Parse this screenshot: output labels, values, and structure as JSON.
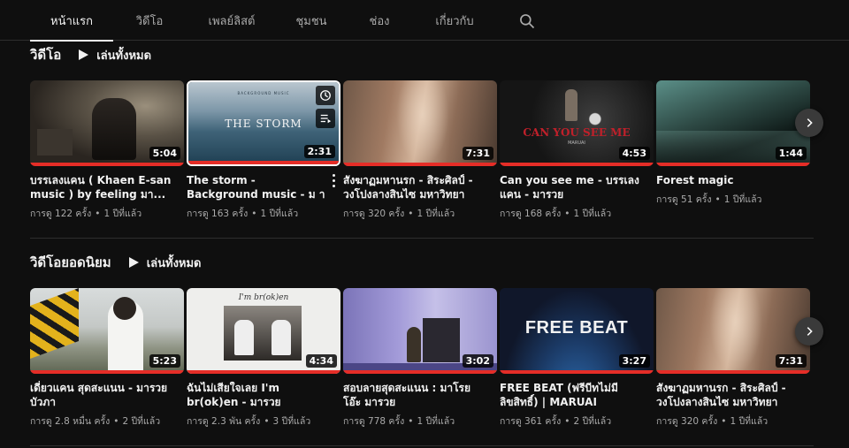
{
  "tabs": [
    {
      "label": "หน้าแรก",
      "active": true
    },
    {
      "label": "วิดีโอ"
    },
    {
      "label": "เพลย์ลิสต์"
    },
    {
      "label": "ชุมชน"
    },
    {
      "label": "ช่อง"
    },
    {
      "label": "เกี่ยวกับ"
    }
  ],
  "sections": [
    {
      "title": "วิดีโอ",
      "play_all": "เล่นทั้งหมด",
      "videos": [
        {
          "title": "บรรเลงแคน ( Khaen E-san music ) by feeling มา...",
          "duration": "5:04",
          "views": "การดู 122 ครั้ง",
          "age": "1 ปีที่แล้ว"
        },
        {
          "title": "The storm - Background music - ม า ร ว ย ( maruai )",
          "duration": "2:31",
          "views": "การดู 163 ครั้ง",
          "age": "1 ปีที่แล้ว",
          "thumb_text": "THE STORM",
          "thumb_small": "BACKGROUND MUSIC"
        },
        {
          "title": "สังฆาฏมหานรก - สิระศิลป์ - วงโปงลางสินไซ มหาวิทยาขอนแก่น",
          "duration": "7:31",
          "views": "การดู 320 ครั้ง",
          "age": "1 ปีที่แล้ว"
        },
        {
          "title": "Can you see me - บรรเลงแคน - มารวย",
          "duration": "4:53",
          "views": "การดู 168 ครั้ง",
          "age": "1 ปีที่แล้ว",
          "thumb_text": "CAN YOU SEE ME",
          "thumb_small": "MARUAI"
        },
        {
          "title": "Forest magic",
          "duration": "1:44",
          "views": "การดู 51 ครั้ง",
          "age": "1 ปีที่แล้ว"
        }
      ]
    },
    {
      "title": "วิดีโอยอดนิยม",
      "play_all": "เล่นทั้งหมด",
      "videos": [
        {
          "title": "เดี่ยวแคน สุดสะแนน - มารวย บัวภา",
          "duration": "5:23",
          "views": "การดู 2.8 หมื่น ครั้ง",
          "age": "2 ปีที่แล้ว"
        },
        {
          "title": "ฉันไม่เสียใจเลย I'm br(ok)en - มารวย",
          "duration": "4:34",
          "views": "การดู 2.3 พัน ครั้ง",
          "age": "3 ปีที่แล้ว",
          "thumb_text": "I'm br(ok)en"
        },
        {
          "title": "สอบลายสุดสะแนน : มาโรยโอ๊ะ มารวย",
          "duration": "3:02",
          "views": "การดู 778 ครั้ง",
          "age": "1 ปีที่แล้ว"
        },
        {
          "title": "FREE BEAT (ฟรีบีทไม่มีลิขสิทธิ์) | MARUAI",
          "duration": "3:27",
          "views": "การดู 361 ครั้ง",
          "age": "2 ปีที่แล้ว",
          "thumb_text": "FREE BEAT"
        },
        {
          "title": "สังฆาฏมหานรก - สิระศิลป์ - วงโปงลางสินไซ มหาวิทยาขอนแก่น",
          "duration": "7:31",
          "views": "การดู 320 ครั้ง",
          "age": "1 ปีที่แล้ว"
        }
      ]
    }
  ],
  "colors": {
    "background": "#0f0f0f",
    "progress": "#e52d27",
    "meta": "#aaaaaa"
  }
}
